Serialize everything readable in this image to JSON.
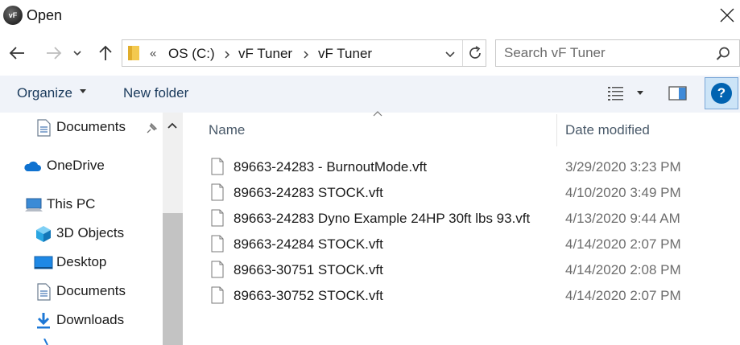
{
  "window": {
    "title": "Open",
    "icon_text": "vF"
  },
  "address": {
    "overflow": "«",
    "crumbs": [
      "OS (C:)",
      "vF Tuner",
      "vF Tuner"
    ]
  },
  "search": {
    "placeholder": "Search vF Tuner"
  },
  "toolbar": {
    "organize_label": "Organize",
    "new_folder_label": "New folder",
    "help_label": "?"
  },
  "sidebar": {
    "items": [
      {
        "label": "Documents",
        "icon": "documents-icon"
      },
      {
        "label": "OneDrive",
        "icon": "onedrive-icon"
      },
      {
        "label": "This PC",
        "icon": "this-pc-icon"
      },
      {
        "label": "3D Objects",
        "icon": "3d-objects-icon"
      },
      {
        "label": "Desktop",
        "icon": "desktop-icon"
      },
      {
        "label": "Documents",
        "icon": "documents-icon"
      },
      {
        "label": "Downloads",
        "icon": "downloads-icon"
      }
    ]
  },
  "file_list": {
    "columns": {
      "name": "Name",
      "date": "Date modified"
    },
    "rows": [
      {
        "name": "89663-24283 - BurnoutMode.vft",
        "date": "3/29/2020 3:23 PM"
      },
      {
        "name": "89663-24283  STOCK.vft",
        "date": "4/10/2020 3:49 PM"
      },
      {
        "name": "89663-24283 Dyno Example 24HP 30ft lbs 93.vft",
        "date": "4/13/2020 9:44 AM"
      },
      {
        "name": "89663-24284  STOCK.vft",
        "date": "4/14/2020 2:07 PM"
      },
      {
        "name": "89663-30751 STOCK.vft",
        "date": "4/14/2020 2:08 PM"
      },
      {
        "name": "89663-30752 STOCK.vft",
        "date": "4/14/2020 2:07 PM"
      }
    ]
  },
  "colors": {
    "accent": "#0078d7",
    "command_bar": "#f0f3f9",
    "help_bg": "#cce4f7"
  }
}
